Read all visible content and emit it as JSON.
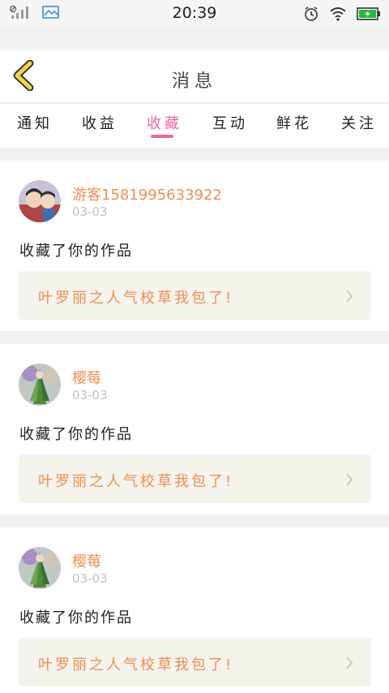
{
  "status_bar": {
    "time": "20:39"
  },
  "header": {
    "title": "消息"
  },
  "tabs": [
    {
      "label": "通知",
      "active": false
    },
    {
      "label": "收益",
      "active": false
    },
    {
      "label": "收藏",
      "active": true
    },
    {
      "label": "互动",
      "active": false
    },
    {
      "label": "鲜花",
      "active": false
    },
    {
      "label": "关注",
      "active": false
    }
  ],
  "messages": [
    {
      "username": "游客1581995633922",
      "date": "03-03",
      "action": "收藏了你的作品",
      "work_title": "叶罗丽之人气校草我包了!",
      "avatar_icon": "child-photo-avatar"
    },
    {
      "username": "樱莓",
      "date": "03-03",
      "action": "收藏了你的作品",
      "work_title": "叶罗丽之人气校草我包了!",
      "avatar_icon": "anime-character-avatar"
    },
    {
      "username": "樱莓",
      "date": "03-03",
      "action": "收藏了你的作品",
      "work_title": "叶罗丽之人气校草我包了!",
      "avatar_icon": "anime-character-avatar"
    }
  ],
  "colors": {
    "accent_pink": "#e86a9f",
    "accent_orange": "#ef8f52",
    "back_arrow_yellow": "#f1d54a"
  }
}
